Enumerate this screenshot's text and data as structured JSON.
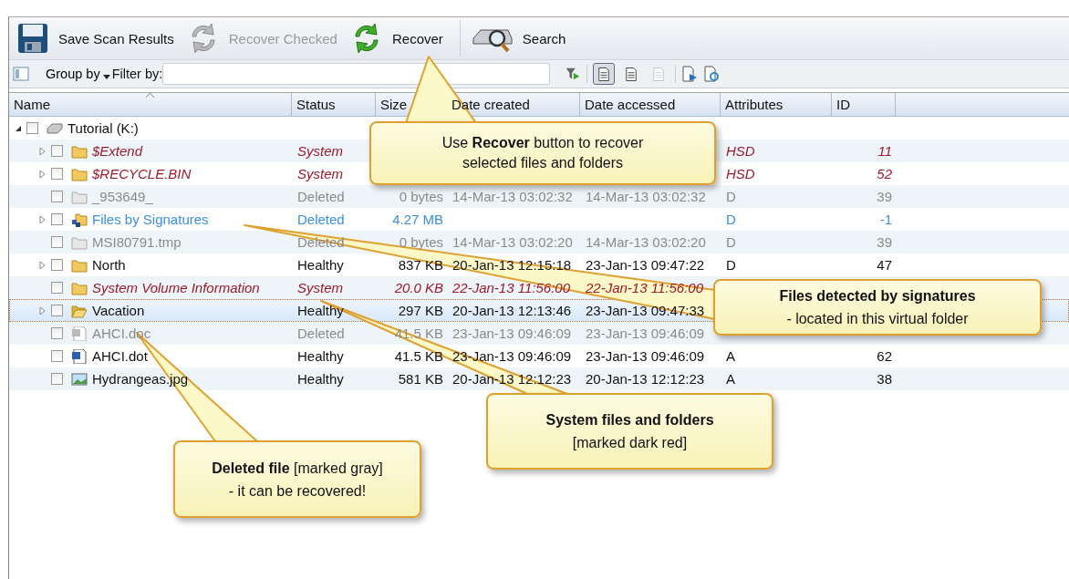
{
  "toolbar": [
    {
      "label": "Save Scan Results",
      "disabled": false
    },
    {
      "label": "Recover Checked",
      "disabled": true
    },
    {
      "label": "Recover",
      "disabled": false
    },
    {
      "label": "Search",
      "disabled": false
    }
  ],
  "filter_bar": {
    "group_by": "Group by",
    "filter_label": "Filter by:",
    "view_buttons": [
      {
        "selected": true
      },
      {
        "selected": false
      },
      {
        "selected": false
      }
    ]
  },
  "table": {
    "columns": [
      "Name",
      "Status",
      "Size",
      "Date created",
      "Date accessed",
      "Attributes",
      "ID"
    ],
    "rows": [
      {
        "name": "Tutorial (K:)",
        "expanded": true,
        "checked": false,
        "selected": false,
        "children": [
          {
            "name": "$Extend",
            "kind": "folder",
            "system": true,
            "deleted": false,
            "expanded": false,
            "checked": false,
            "selected": false,
            "cells": {
              "status": "System",
              "attributes": "HSD",
              "id": "11"
            }
          },
          {
            "name": "$RECYCLE.BIN",
            "kind": "folder",
            "system": true,
            "deleted": false,
            "expanded": false,
            "checked": false,
            "selected": false,
            "cells": {
              "status": "System",
              "attributes": "HSD",
              "id": "52"
            }
          },
          {
            "name": "_953649_",
            "kind": "folder",
            "system": false,
            "deleted": true,
            "checked": false,
            "selected": false,
            "cells": {
              "status": "Deleted",
              "size": "0 bytes",
              "created": "14-Mar-13 03:02:32",
              "accessed": "14-Mar-13 03:02:32",
              "attributes": "D",
              "id": "39"
            }
          },
          {
            "name": "Files by Signatures",
            "kind": "virtual-folder",
            "expanded": false,
            "checked": false,
            "selected": false,
            "cells": {
              "status": "Deleted",
              "size": "4.27 MB",
              "attributes": "D",
              "id": "-1"
            }
          },
          {
            "name": "MSI80791.tmp",
            "kind": "folder",
            "system": false,
            "deleted": true,
            "checked": false,
            "selected": false,
            "cells": {
              "status": "Deleted",
              "size": "0 bytes",
              "created": "14-Mar-13 03:02:20",
              "accessed": "14-Mar-13 03:02:20",
              "attributes": "D",
              "id": "39"
            }
          },
          {
            "name": "North",
            "kind": "folder",
            "system": false,
            "deleted": false,
            "expanded": false,
            "checked": false,
            "selected": false,
            "cells": {
              "status": "Healthy",
              "size": "837 KB",
              "created": "20-Jan-13 12:15:18",
              "accessed": "23-Jan-13 09:47:22",
              "attributes": "D",
              "id": "47"
            }
          },
          {
            "name": "System Volume Information",
            "kind": "folder",
            "system": true,
            "deleted": false,
            "checked": false,
            "selected": false,
            "cells": {
              "status": "System",
              "size": "20.0 KB",
              "created": "22-Jan-13 11:56:00",
              "accessed": "22-Jan-13 11:56:00"
            }
          },
          {
            "name": "Vacation",
            "kind": "folder",
            "system": false,
            "deleted": false,
            "expanded": false,
            "checked": false,
            "selected": true,
            "cells": {
              "status": "Healthy",
              "size": "297 KB",
              "created": "20-Jan-13 12:13:46",
              "accessed": "23-Jan-13 09:47:33"
            }
          },
          {
            "name": "AHCI.doc",
            "kind": "document",
            "system": false,
            "deleted": true,
            "checked": false,
            "selected": false,
            "cells": {
              "status": "Deleted",
              "size": "41.5 KB",
              "created": "23-Jan-13 09:46:09",
              "accessed": "23-Jan-13 09:46:09"
            }
          },
          {
            "name": "AHCI.dot",
            "kind": "document",
            "system": false,
            "deleted": false,
            "checked": false,
            "selected": false,
            "cells": {
              "status": "Healthy",
              "size": "41.5 KB",
              "created": "23-Jan-13 09:46:09",
              "accessed": "23-Jan-13 09:46:09",
              "attributes": "A",
              "id": "62"
            }
          },
          {
            "name": "Hydrangeas.jpg",
            "kind": "image",
            "system": false,
            "deleted": false,
            "checked": false,
            "selected": false,
            "cells": {
              "status": "Healthy",
              "size": "581 KB",
              "created": "20-Jan-13 12:12:23",
              "accessed": "20-Jan-13 12:12:23",
              "attributes": "A",
              "id": "38"
            }
          }
        ]
      }
    ]
  },
  "callouts": [
    {
      "lines": [
        "Use **Recover** button to recover",
        "selected files and folders"
      ]
    },
    {
      "lines": [
        "**Files detected by signatures**",
        "- located in this virtual folder"
      ]
    },
    {
      "lines": [
        "**System files and folders**",
        "[marked dark red]"
      ]
    },
    {
      "lines": [
        "**Deleted file** [marked gray]",
        "- it can be recovered!"
      ]
    }
  ]
}
